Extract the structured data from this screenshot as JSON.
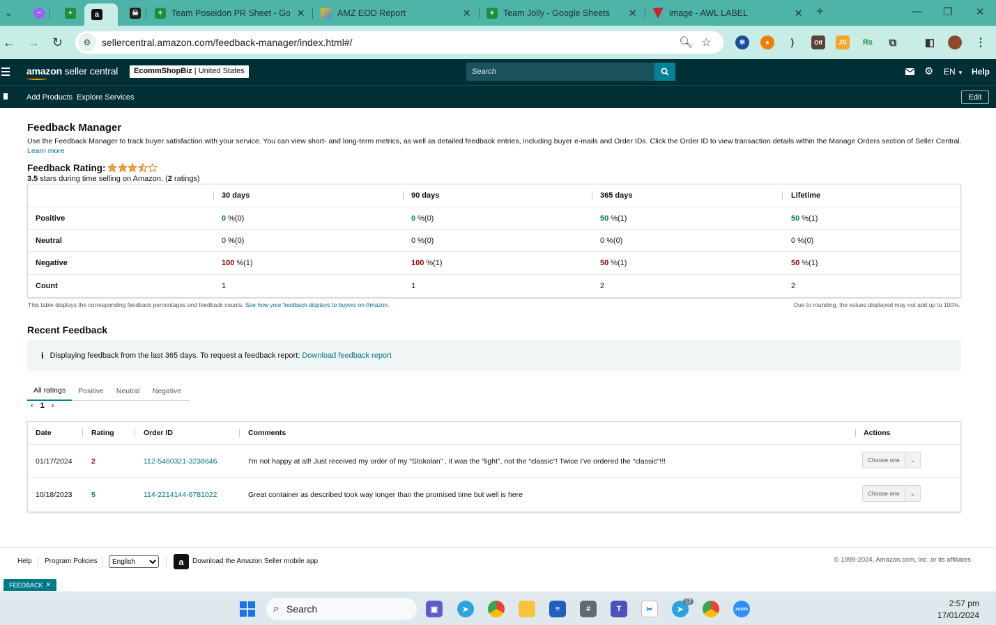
{
  "browser": {
    "tabs": [
      {
        "title": "Team Poseidon PR Sheet - Goo",
        "favicon": "google-sheets-icon"
      },
      {
        "title": "AMZ EOD Report",
        "favicon": "apps-script-icon"
      },
      {
        "title": "Team Jolly - Google Sheets",
        "favicon": "google-sheets-icon"
      },
      {
        "title": "image - AWL LABEL",
        "favicon": "label-icon"
      }
    ],
    "url": "sellercentral.amazon.com/feedback-manager/index.html#/"
  },
  "header": {
    "logo_prefix": "amazon",
    "logo_suffix": " seller central",
    "store_name": "EcommShopBiz",
    "store_separator": " | ",
    "store_region": "United States",
    "search_placeholder": "Search",
    "language": "EN",
    "help": "Help"
  },
  "subnav": {
    "links": [
      "Add Products",
      "Explore Services"
    ],
    "edit": "Edit"
  },
  "page": {
    "title": "Feedback Manager",
    "description": "Use the Feedback Manager to track buyer satisfaction with your service. You can view short- and long-term metrics, as well as detailed feedback entries, including buyer e-mails and Order IDs. Click the Order ID to view transaction details within the Manage Orders section of Seller Central. ",
    "learn_more": "Learn more",
    "rating_label": "Feedback Rating:",
    "rating_value": 3.5,
    "rating_max": 5,
    "rating_summary_value": "3.5",
    "rating_summary_text": " stars during time selling on Amazon. (",
    "rating_count": "2",
    "rating_summary_end": " ratings)"
  },
  "metrics": {
    "columns": [
      "30 days",
      "90 days",
      "365 days",
      "Lifetime"
    ],
    "rows": [
      {
        "label": "Positive",
        "kind": "pos",
        "cells": [
          [
            "0",
            "%(0)"
          ],
          [
            "0",
            "%(0)"
          ],
          [
            "50",
            "%(1)"
          ],
          [
            "50",
            "%(1)"
          ]
        ]
      },
      {
        "label": "Neutral",
        "kind": "neu",
        "cells": [
          [
            "0",
            "%(0)"
          ],
          [
            "0",
            "%(0)"
          ],
          [
            "0",
            "%(0)"
          ],
          [
            "0",
            "%(0)"
          ]
        ]
      },
      {
        "label": "Negative",
        "kind": "neg",
        "cells": [
          [
            "100",
            "%(1)"
          ],
          [
            "100",
            "%(1)"
          ],
          [
            "50",
            "%(1)"
          ],
          [
            "50",
            "%(1)"
          ]
        ]
      },
      {
        "label": "Count",
        "kind": "count",
        "cells": [
          [
            "1",
            ""
          ],
          [
            "1",
            ""
          ],
          [
            "2",
            ""
          ],
          [
            "2",
            ""
          ]
        ]
      }
    ],
    "note_left": "This table displays the corresponding feedback percentages and feedback counts. ",
    "note_link": "See how your feedback displays to buyers on Amazon.",
    "note_right": "Due to rounding, the values displayed may not add up to 100%."
  },
  "recent": {
    "title": "Recent Feedback",
    "info_text": "Displaying feedback from the last 365 days. To request a feedback report: ",
    "info_link": "Download feedback report",
    "tabs": [
      "All ratings",
      "Positive",
      "Neutral",
      "Negative"
    ],
    "page": "1",
    "headers": {
      "date": "Date",
      "rating": "Rating",
      "order_id": "Order ID",
      "comments": "Comments",
      "actions": "Actions"
    },
    "action_label": "Choose one",
    "rows": [
      {
        "date": "01/17/2024",
        "rating": "2",
        "order_id": "112-5460321-3238646",
        "comment": "I'm not happy at all! Just received my order of my “Stokolan” , it was the “light”, not the “classic”! Twice I've ordered the “classic”!!!"
      },
      {
        "date": "10/18/2023",
        "rating": "5",
        "order_id": "114-2214144-6781022",
        "comment": "Great container as described took way longer than the promised time but well is here"
      }
    ]
  },
  "footer": {
    "help": "Help",
    "policies": "Program Policies",
    "language": "English",
    "app": "Download the Amazon Seller mobile app",
    "copyright": "© 1999-2024, Amazon.com, Inc. or its affiliates",
    "feedback_tab": "FEEDBACK"
  },
  "taskbar": {
    "search": "Search",
    "time": "2:57 pm",
    "date": "17/01/2024",
    "telegram_badge": "12"
  },
  "colors": {
    "header_bg": "#002f36",
    "accent": "#008296",
    "positive": "#067d62",
    "negative": "#8b0000",
    "star": "#ffa41c"
  }
}
